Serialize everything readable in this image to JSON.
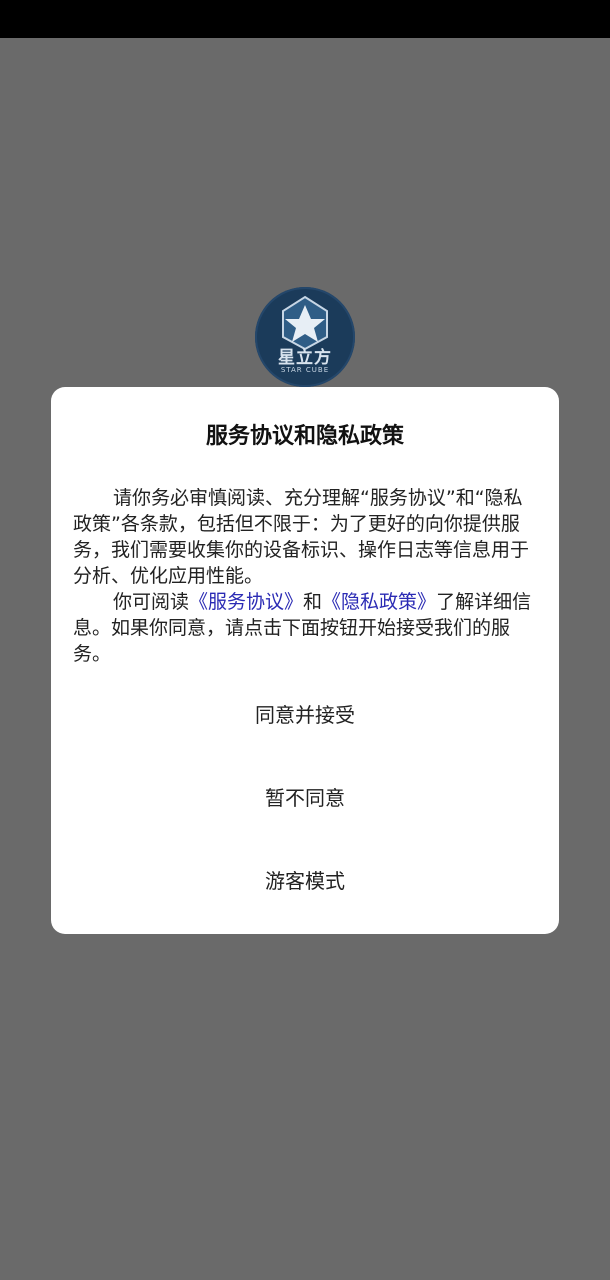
{
  "logo": {
    "cn": "星立方",
    "en": "STAR CUBE"
  },
  "dialog": {
    "title": "服务协议和隐私政策",
    "para1": "请你务必审慎阅读、充分理解“服务协议”和“隐私政策”各条款，包括但不限于：为了更好的向你提供服务，我们需要收集你的设备标识、操作日志等信息用于分析、优化应用性能。",
    "para2_prefix": "你可阅读",
    "link_service": "《服务协议》",
    "para2_and": "和",
    "link_privacy": "《隐私政策》",
    "para2_suffix": "了解详细信息。如果你同意，请点击下面按钮开始接受我们的服务。",
    "agree_button": "同意并接受",
    "disagree_button": "暂不同意",
    "guest_button": "游客模式"
  },
  "colors": {
    "backdrop": "#6a6a6a",
    "status_bar": "#000000",
    "link": "#2a2ab4",
    "logo_bg": "#1b3b5a"
  }
}
